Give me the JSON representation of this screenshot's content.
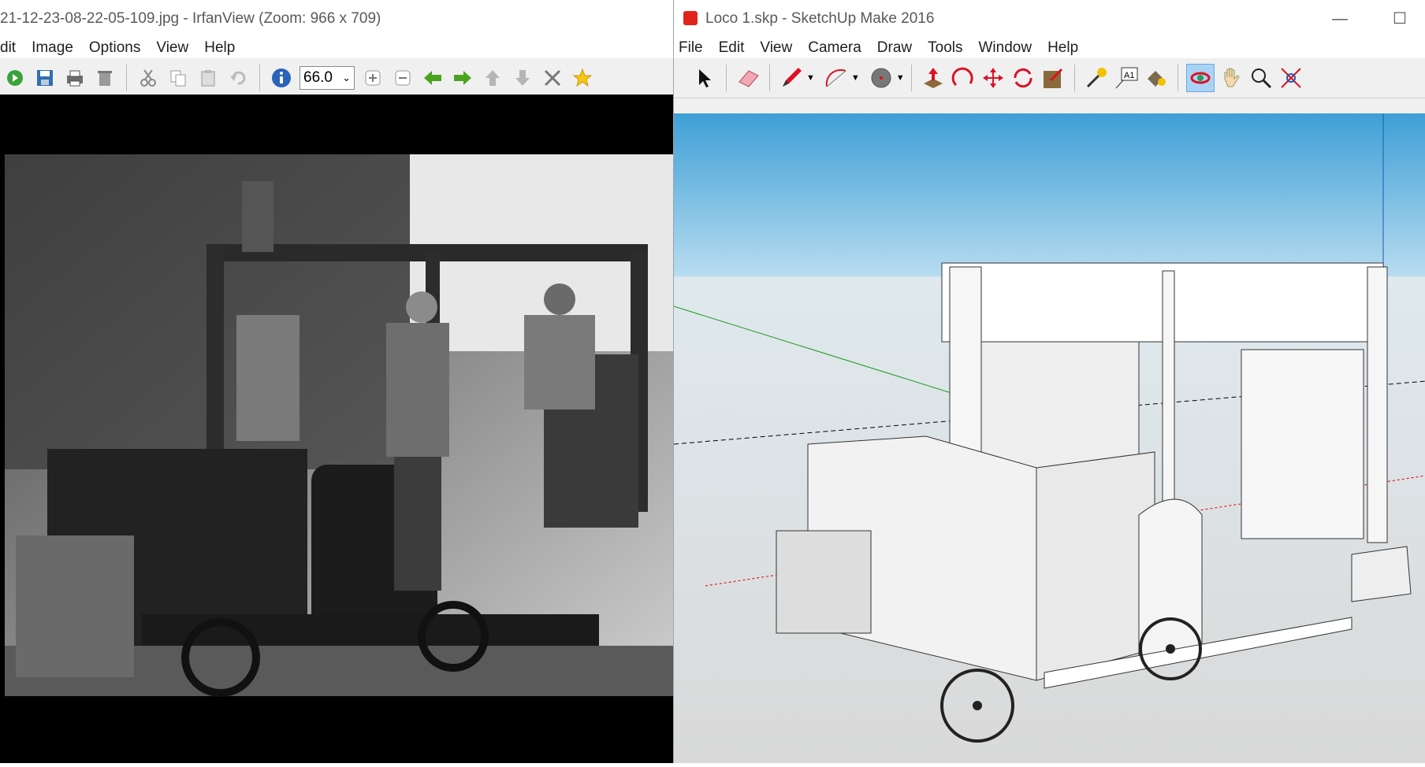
{
  "irfan": {
    "title": "21-12-23-08-22-05-109.jpg - IrfanView (Zoom: 966 x 709)",
    "menu": [
      "dit",
      "Image",
      "Options",
      "View",
      "Help"
    ],
    "zoom_value": "66.0"
  },
  "sketchup": {
    "title": "Loco 1.skp - SketchUp Make 2016",
    "menu": [
      "File",
      "Edit",
      "View",
      "Camera",
      "Draw",
      "Tools",
      "Window",
      "Help"
    ]
  },
  "icons": {
    "select": "select-arrow-icon",
    "eraser": "eraser-icon",
    "pencil": "pencil-icon",
    "arc": "arc-icon",
    "circle": "circle-icon",
    "pushpull": "push-pull-icon",
    "followme": "follow-me-icon",
    "move": "move-icon",
    "rotate": "rotate-icon",
    "scale": "scale-icon",
    "tape": "tape-measure-icon",
    "text": "text-icon",
    "paint": "paint-bucket-icon",
    "orbit": "orbit-icon",
    "pan": "pan-icon",
    "zoom": "zoom-icon",
    "zoomext": "zoom-extents-icon"
  },
  "colors": {
    "sky": "#3e9fd6",
    "ground": "#d9d9d9",
    "orbit_active": "#a9d3f5"
  },
  "text_tool_label": "A1"
}
